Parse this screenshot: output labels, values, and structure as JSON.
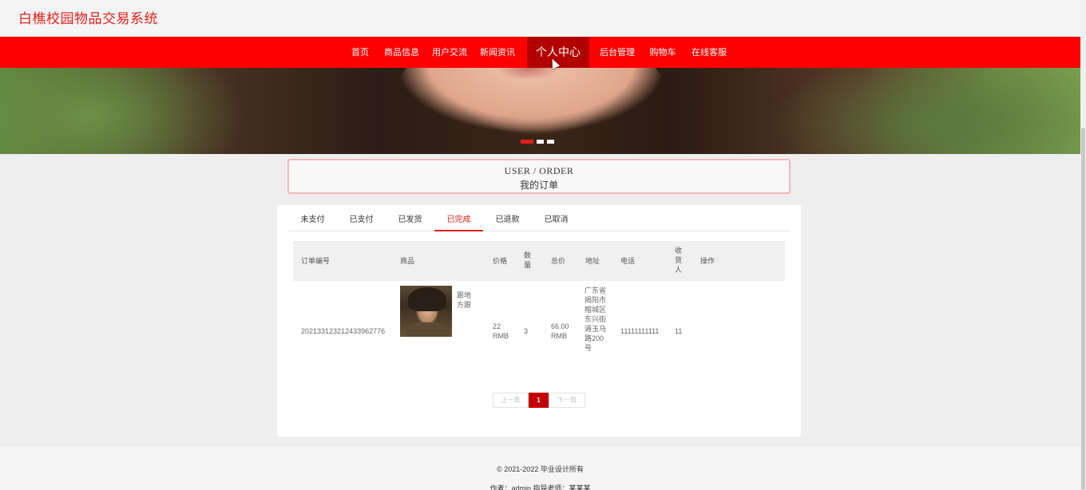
{
  "header": {
    "site_title": "白樵校园物品交易系统"
  },
  "nav": {
    "items": [
      {
        "label": "首页"
      },
      {
        "label": "商品信息"
      },
      {
        "label": "用户交流"
      },
      {
        "label": "新闻资讯"
      },
      {
        "label": "个人中心"
      },
      {
        "label": "后台管理"
      },
      {
        "label": "购物车"
      },
      {
        "label": "在线客服"
      }
    ],
    "active": "个人中心"
  },
  "banner": {
    "slide_count": 3,
    "active_slide": 1
  },
  "section_title": {
    "en": "USER / ORDER",
    "zh": "我的订单"
  },
  "tabs": {
    "items": [
      {
        "label": "未支付"
      },
      {
        "label": "已支付"
      },
      {
        "label": "已发货"
      },
      {
        "label": "已完成"
      },
      {
        "label": "已退款"
      },
      {
        "label": "已取消"
      }
    ],
    "active": "已完成"
  },
  "table": {
    "headers": {
      "order_no": "订单编号",
      "goods": "商品",
      "price": "价格",
      "qty": "数量",
      "total": "总价",
      "address": "地址",
      "phone": "电话",
      "receiver": "收货人",
      "action": "操作"
    },
    "rows": [
      {
        "order_no": "20213312321243396277​6",
        "goods_name": "跟地方跟",
        "price": "22 RMB",
        "qty": "3",
        "total": "66.00 RMB",
        "address": "广东省揭阳市榕城区东兴街道玉马路200号",
        "phone": "11111111111",
        "receiver": "11",
        "action": ""
      }
    ]
  },
  "pagination": {
    "prev": "上一页",
    "current": "1",
    "next": "下一页"
  },
  "footer": {
    "copyright": "© 2021-2022 毕业设计所有",
    "credits": "作者：admin 指导老师：某某某"
  },
  "colors": {
    "brand_red": "#ff0000",
    "nav_active": "#b30000",
    "accent": "#e0211b"
  }
}
